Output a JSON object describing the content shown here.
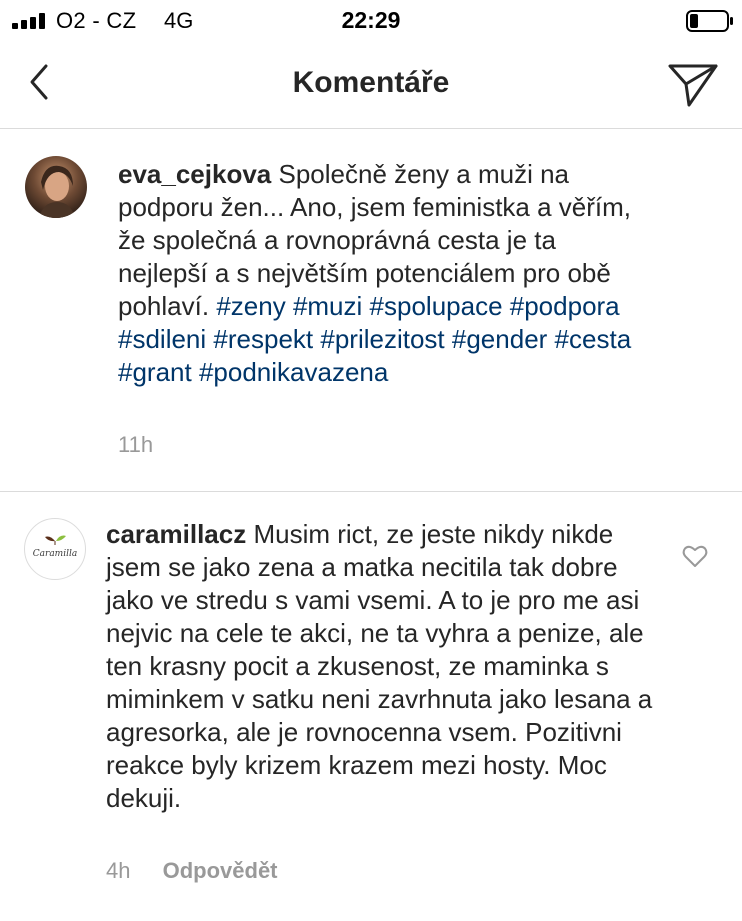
{
  "status_bar": {
    "carrier": "O2 - CZ",
    "network": "4G",
    "time": "22:29",
    "signal_icon": "signal-bars-icon",
    "battery_icon": "battery-low-icon"
  },
  "nav": {
    "title": "Komentáře",
    "back_icon": "chevron-left-icon",
    "send_icon": "paper-plane-icon"
  },
  "comments": [
    {
      "username": "eva_cejkova",
      "text": "Společně ženy a muži na podporu žen... Ano, jsem feministka a věřím, že společná a rovnoprávná cesta je ta nejlepší a s největším potenciálem pro obě pohlaví.",
      "hashtags": [
        "#zeny",
        "#muzi",
        "#spolupace",
        "#podpora",
        "#sdileni",
        "#respekt",
        "#prilezitost",
        "#gender",
        "#cesta",
        "#grant",
        "#podnikavazena"
      ],
      "time": "11h"
    },
    {
      "username": "caramillacz",
      "avatar_text": "Caramilla",
      "text": "Musim rict, ze jeste nikdy nikde jsem se jako zena a matka necitila tak dobre jako ve stredu s vami vsemi. A to je pro me asi nejvic na cele te akci, ne ta vyhra a penize, ale ten krasny pocit a zkusenost, ze maminka s miminkem v satku neni zavrhnuta jako lesana a agresorka, ale je rovnocenna vsem. Pozitivni reakce byly krizem krazem mezi hosty. Moc dekuji.",
      "time": "4h",
      "reply_label": "Odpovědět",
      "like_icon": "heart-outline-icon"
    }
  ],
  "colors": {
    "text": "#262626",
    "hashtag": "#003569",
    "meta": "#999999",
    "divider": "#dbdbdb"
  }
}
